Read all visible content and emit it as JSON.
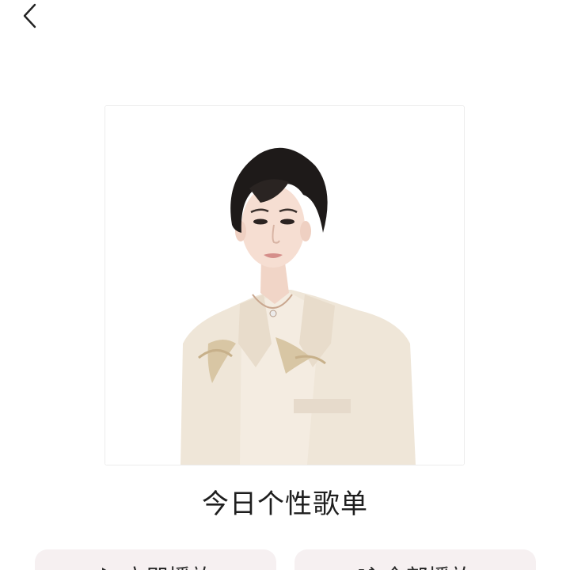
{
  "nav": {
    "back_icon": "chevron-left-icon"
  },
  "cover": {
    "image_subject": "portrait-photo"
  },
  "playlist": {
    "title": "今日个性歌单"
  },
  "actions": {
    "play_label": "立即播放",
    "shuffle_label": "全部播放"
  },
  "colors": {
    "background": "#ffffff",
    "button_bg": "#f6f0f1",
    "text": "#1e1e1e"
  }
}
